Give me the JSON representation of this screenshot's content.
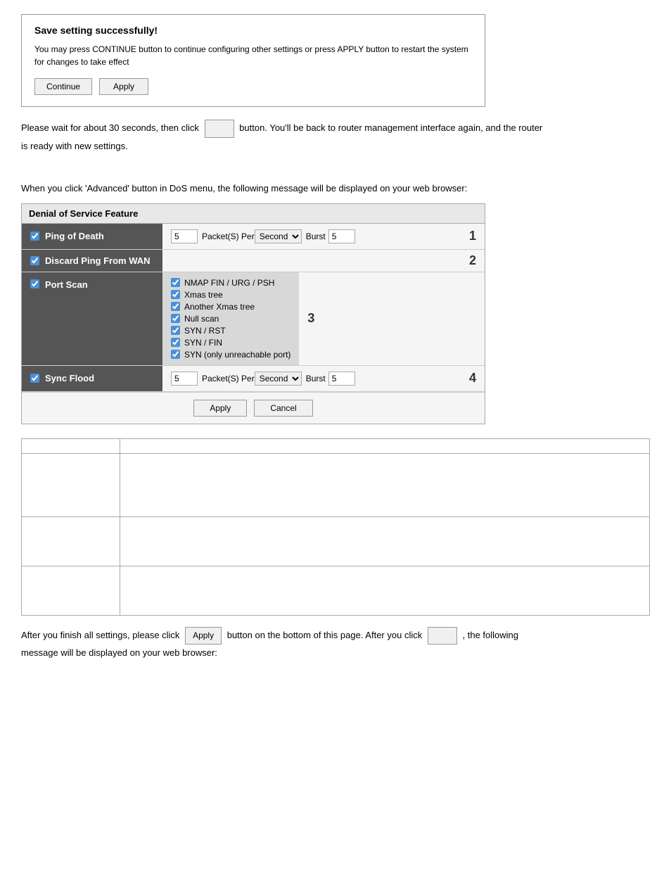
{
  "save_box": {
    "title": "Save setting successfully!",
    "body": "You may press CONTINUE button to continue configuring other settings or press APPLY button to restart the system for changes to take effect",
    "continue_label": "Continue",
    "apply_label": "Apply"
  },
  "instructions": {
    "line1_before": "Please wait for about 30 seconds, then click",
    "line1_button": "      ",
    "line1_after": "button. You'll be back to router management interface again, and the router",
    "line2": "is ready with new settings."
  },
  "dos_intro": "When you click 'Advanced' button in DoS menu, the following message will be displayed on your web browser:",
  "dos_panel": {
    "title": "Denial of Service Feature",
    "rows": [
      {
        "id": "ping-of-death",
        "label": "Ping of Death",
        "number": "1",
        "type": "rate",
        "checked": true,
        "value": "5",
        "per_unit": "Second",
        "burst": "5"
      },
      {
        "id": "discard-ping",
        "label": "Discard Ping From WAN",
        "number": "2",
        "type": "empty",
        "checked": true
      },
      {
        "id": "port-scan",
        "label": "Port Scan",
        "number": "3",
        "type": "options",
        "checked": true,
        "options": [
          {
            "label": "NMAP FIN / URG / PSH",
            "checked": true
          },
          {
            "label": "Xmas tree",
            "checked": true
          },
          {
            "label": "Another Xmas tree",
            "checked": true
          },
          {
            "label": "Null scan",
            "checked": true
          },
          {
            "label": "SYN / RST",
            "checked": true
          },
          {
            "label": "SYN / FIN",
            "checked": true
          },
          {
            "label": "SYN (only unreachable port)",
            "checked": true
          }
        ]
      },
      {
        "id": "sync-flood",
        "label": "Sync Flood",
        "number": "4",
        "type": "rate",
        "checked": true,
        "value": "5",
        "per_unit": "Second",
        "burst": "5"
      }
    ],
    "apply_label": "Apply",
    "cancel_label": "Cancel"
  },
  "table": {
    "rows": [
      {
        "col1": "",
        "col2": ""
      },
      {
        "col1": "",
        "col2": ""
      },
      {
        "col1": "",
        "col2": ""
      },
      {
        "col1": "",
        "col2": ""
      }
    ]
  },
  "footer": {
    "before": "After you finish all settings, please click",
    "btn1": "Apply",
    "middle": "button on the bottom of this page. After you click",
    "btn2": "       ",
    "after": ", the following",
    "line2": "message will be displayed on your web browser:"
  }
}
